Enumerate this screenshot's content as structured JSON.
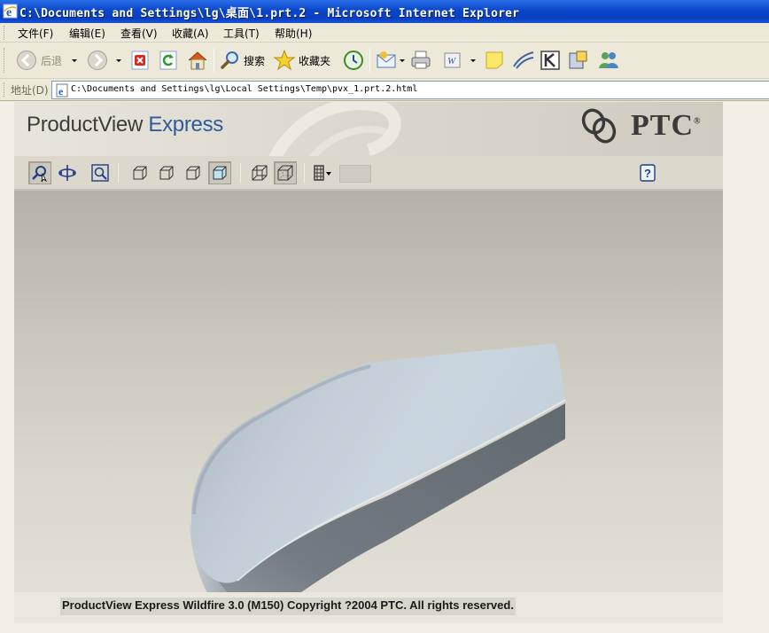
{
  "window": {
    "title": "C:\\Documents and Settings\\lg\\桌面\\1.prt.2 - Microsoft Internet Explorer",
    "app_icon": "ie-icon"
  },
  "menu": {
    "items": [
      "文件(F)",
      "编辑(E)",
      "查看(V)",
      "收藏(A)",
      "工具(T)",
      "帮助(H)"
    ]
  },
  "toolbar": {
    "back_label": "后退",
    "search_label": "搜索",
    "favorites_label": "收藏夹",
    "icons": [
      "back-icon",
      "forward-icon",
      "stop-icon",
      "refresh-icon",
      "home-icon",
      "search-icon",
      "favorites-icon",
      "history-icon",
      "mail-icon",
      "print-icon",
      "word-icon",
      "notes-icon",
      "messenger-icon",
      "k-icon",
      "media-icon",
      "users-icon"
    ]
  },
  "address": {
    "label": "地址(D)",
    "url": "C:\\Documents and Settings\\lg\\Local Settings\\Temp\\pvx_1.prt.2.html"
  },
  "productview": {
    "title_main": "ProductView ",
    "title_accent": "Express",
    "brand": "PTC",
    "brand_mark": "®",
    "tools": [
      "pick-zoom-icon",
      "pan-rotate-icon",
      "zoom-window-icon",
      "view-front-icon",
      "view-top-icon",
      "view-right-icon",
      "view-isometric-icon",
      "wireframe-icon",
      "hidden-line-icon",
      "animation-icon",
      "help-icon"
    ],
    "copyright": "ProductView Express Wildfire 3.0 (M150) Copyright ?2004 PTC.  All rights reserved."
  },
  "colors": {
    "titlebar": "#0a46c9",
    "model_top": "#c6d3dc",
    "model_side": "#6e757c",
    "accent_text": "#2f5b9a"
  }
}
